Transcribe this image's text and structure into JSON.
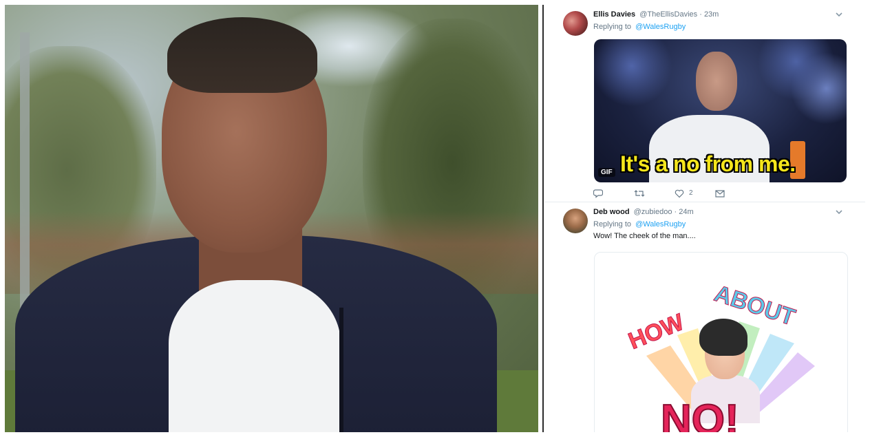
{
  "photo": {
    "alt": "man in navy hoodie and white t-shirt standing outdoors"
  },
  "tweets": [
    {
      "display_name": "Ellis Davies",
      "handle": "@TheEllisDavies",
      "time": "23m",
      "replying_to_label": "Replying to",
      "replying_to": "@WalesRugby",
      "media": {
        "type": "gif",
        "badge": "GIF",
        "caption": "It's a no from me."
      },
      "actions": {
        "reply_icon": "reply-icon",
        "retweet_icon": "retweet-icon",
        "like_icon": "heart-icon",
        "like_count": "2",
        "dm_icon": "envelope-icon"
      }
    },
    {
      "display_name": "Deb wood",
      "handle": "@zubiedoo",
      "time": "24m",
      "replying_to_label": "Replying to",
      "replying_to": "@WalesRugby",
      "text": "Wow! The cheek of the man....",
      "media": {
        "type": "image",
        "word1": "HOW",
        "word2": "ABOUT",
        "word3": "NO!"
      }
    }
  ],
  "colors": {
    "link": "#1da1f2",
    "muted": "#657786",
    "text": "#14171a",
    "gif_caption": "#f5e61b"
  }
}
